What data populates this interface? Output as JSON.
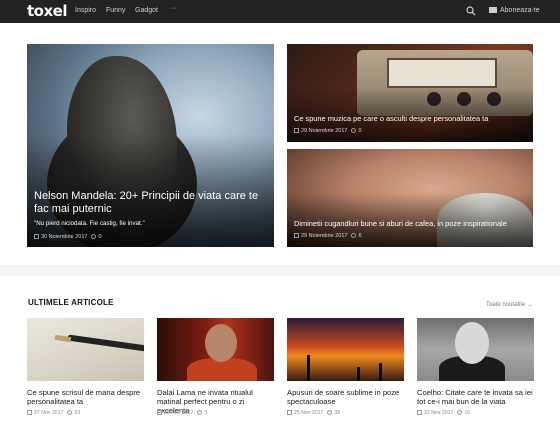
{
  "nav": {
    "logo": "toxel",
    "links": [
      "Inspiro",
      "Funny",
      "Gadgot",
      "···"
    ],
    "subscribe": "Aboneaza-te"
  },
  "hero": {
    "main": {
      "title": "Nelson Mandela: 20+ Principii de viata care te fac mai puternic",
      "quote": "\"Nu pierd niciodata. Fie castig, fie invat.\"",
      "date": "30 Noiembrie 2017",
      "shares": "0"
    },
    "side": [
      {
        "title": "Ce spune muzica pe care o asculti despre personalitatea ta",
        "date": "29 Noiembrie 2017",
        "shares": "0"
      },
      {
        "title": "Diminetii cugandluri bune si aburi de cafea, in poze inspirationale",
        "date": "29 Noiembrie 2017",
        "shares": "6"
      }
    ]
  },
  "latest": {
    "heading": "ULTIMELE ARTICOLE",
    "all_link": "Toate noutatile →",
    "items": [
      {
        "title": "Ce spune scrisul de mana despre personalitatea ta",
        "date": "27 Nov 2017",
        "shares": "23"
      },
      {
        "title": "Dalai Lama ne invata ritualul matinal perfect pentru o zi excelenta",
        "date": "25 Nov 2017",
        "shares": "5"
      },
      {
        "title": "Apusuri de soare sublime in poze spectaculoase",
        "date": "25 Nov 2017",
        "shares": "38"
      },
      {
        "title": "Coelho: Citate care te invata sa iei tot ce-i mai bun de la viata",
        "date": "22 Nov 2017",
        "shares": "16"
      }
    ]
  },
  "colors": {
    "nav_bg": "#222222",
    "page_bg": "#f4f4f4"
  }
}
